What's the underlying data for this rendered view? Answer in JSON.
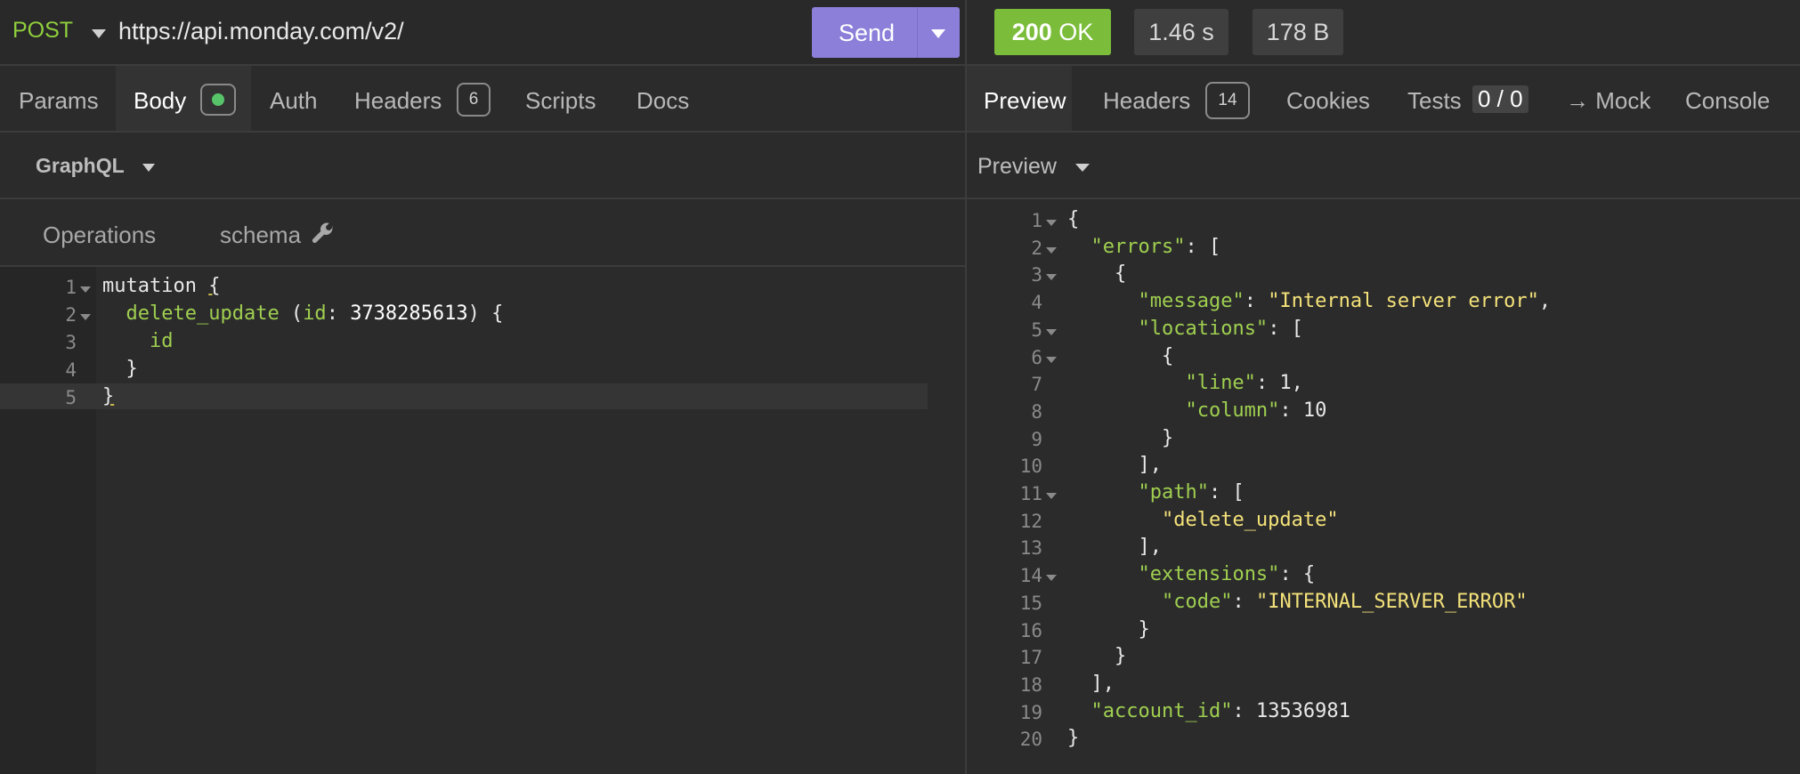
{
  "request": {
    "method": "POST",
    "url": "https://api.monday.com/v2/",
    "send_label": "Send"
  },
  "request_tabs": [
    {
      "label": "Params"
    },
    {
      "label": "Body"
    },
    {
      "label": "Auth"
    },
    {
      "label": "Headers",
      "count": "6"
    },
    {
      "label": "Scripts"
    },
    {
      "label": "Docs"
    }
  ],
  "body_type": "GraphQL",
  "graphql_tabs": {
    "operations": "Operations",
    "schema": "schema"
  },
  "query_lines": [
    {
      "n": "1",
      "t1": "mutation ",
      "t2": "{"
    },
    {
      "n": "2",
      "fn": "delete_update",
      "sp": " (",
      "arg": "id",
      "colon": ": ",
      "val": "3738285613",
      "end": ") {"
    },
    {
      "n": "3",
      "field": "id"
    },
    {
      "n": "4",
      "text": "}"
    },
    {
      "n": "5",
      "text": "}"
    }
  ],
  "response": {
    "status_code": "200",
    "status_text": "OK",
    "time": "1.46 s",
    "size": "178 B"
  },
  "response_tabs": [
    {
      "label": "Preview"
    },
    {
      "label": "Headers",
      "count": "14"
    },
    {
      "label": "Cookies"
    },
    {
      "label": "Tests",
      "badge": "0 / 0"
    },
    {
      "label": "→ Mock"
    },
    {
      "label": "Console"
    }
  ],
  "preview_mode": "Preview",
  "response_lines": [
    {
      "n": "1",
      "html": "{"
    },
    {
      "n": "2",
      "key": "\"errors\"",
      "rest": ": ["
    },
    {
      "n": "3",
      "rest": "{"
    },
    {
      "n": "4",
      "key": "\"message\"",
      "rest": ": ",
      "str": "\"Internal server error\"",
      "tail": ","
    },
    {
      "n": "5",
      "key": "\"locations\"",
      "rest": ": ["
    },
    {
      "n": "6",
      "rest": "{"
    },
    {
      "n": "7",
      "key": "\"line\"",
      "rest": ": 1,"
    },
    {
      "n": "8",
      "key": "\"column\"",
      "rest": ": 10"
    },
    {
      "n": "9",
      "rest": "}"
    },
    {
      "n": "10",
      "rest": "],"
    },
    {
      "n": "11",
      "key": "\"path\"",
      "rest": ": ["
    },
    {
      "n": "12",
      "str": "\"delete_update\""
    },
    {
      "n": "13",
      "rest": "],"
    },
    {
      "n": "14",
      "key": "\"extensions\"",
      "rest": ": {"
    },
    {
      "n": "15",
      "key": "\"code\"",
      "rest": ": ",
      "str": "\"INTERNAL_SERVER_ERROR\""
    },
    {
      "n": "16",
      "rest": "}"
    },
    {
      "n": "17",
      "rest": "}"
    },
    {
      "n": "18",
      "rest": "],"
    },
    {
      "n": "19",
      "key": "\"account_id\"",
      "rest": ": 13536981"
    },
    {
      "n": "20",
      "rest": "}"
    }
  ]
}
